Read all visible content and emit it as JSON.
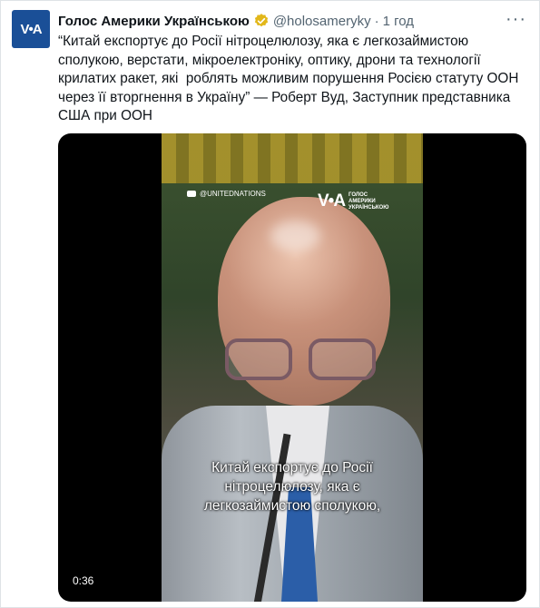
{
  "account": {
    "avatar_text": "V•A",
    "name": "Голос Америки Українською",
    "handle": "@holosameryky",
    "separator": "·",
    "time": "1 год",
    "verified_color": "#e2b719"
  },
  "tweet": {
    "text": "“Китай експортує до Росії нітроцелюлозу, яка є легкозаймистою сполукою, верстати, мікроелектроніку, оптику, дрони та технології крилатих ракет, які  роблять можливим порушення Росією статуту ООН через її вторгнення в Україну” — Роберт Вуд, Заступник представника США при ООН"
  },
  "video": {
    "source_tag": "@UNITEDNATIONS",
    "logo_mark": "V•A",
    "logo_sub_1": "ГОЛОС",
    "logo_sub_2": "АМЕРИКИ",
    "logo_sub_3": "УКРАЇНСЬКОЮ",
    "subtitle": "Китай експортує до Росії\nнітроцелюлозу, яка є\nлегкозаймистою сполукою,",
    "duration": "0:36"
  },
  "icons": {
    "more": "more-icon",
    "verified": "verified-icon",
    "youtube": "play-icon"
  },
  "colors": {
    "brand": "#1a4f97",
    "secondary_text": "#536471"
  }
}
